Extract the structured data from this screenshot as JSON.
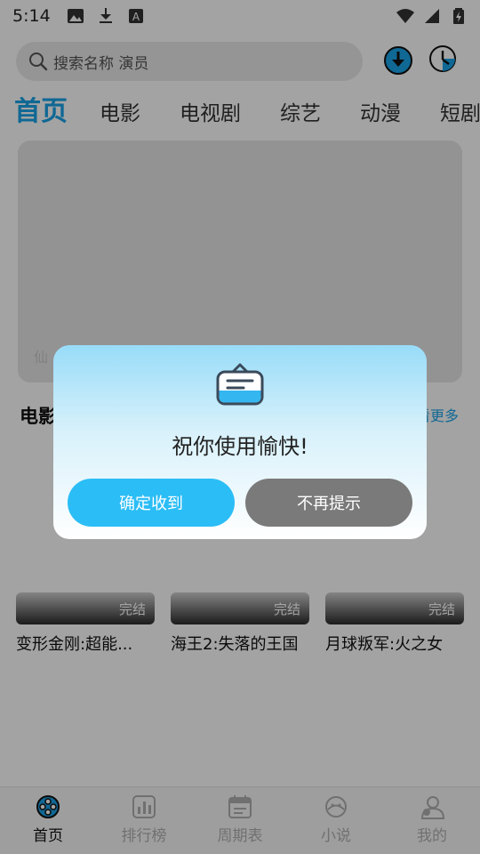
{
  "status_bar": {
    "time": "5:14",
    "icons_left": [
      "image-icon",
      "download-icon",
      "font-icon"
    ],
    "icons_right": [
      "wifi-icon",
      "signal-icon",
      "battery-icon"
    ]
  },
  "search": {
    "placeholder": "搜索名称 演员",
    "download_icon": "download-circle-icon",
    "history_icon": "history-clock-icon"
  },
  "tabs": [
    {
      "label": "首页",
      "active": true
    },
    {
      "label": "电影",
      "active": false
    },
    {
      "label": "电视剧",
      "active": false
    },
    {
      "label": "综艺",
      "active": false
    },
    {
      "label": "动漫",
      "active": false
    },
    {
      "label": "短剧",
      "active": false
    }
  ],
  "banner": {
    "caption": "仙"
  },
  "section": {
    "title": "电影",
    "more": "看更多"
  },
  "movies": [
    {
      "title": "变形金刚:超能...",
      "badge": "完结"
    },
    {
      "title": "海王2:失落的王国",
      "badge": "完结"
    },
    {
      "title": "月球叛军:火之女",
      "badge": "完结"
    }
  ],
  "bottom_nav": [
    {
      "label": "首页",
      "icon": "home-film-reel-icon",
      "active": true
    },
    {
      "label": "排行榜",
      "icon": "ranking-chart-icon",
      "active": false
    },
    {
      "label": "周期表",
      "icon": "calendar-icon",
      "active": false
    },
    {
      "label": "小说",
      "icon": "novel-icon",
      "active": false
    },
    {
      "label": "我的",
      "icon": "profile-icon",
      "active": false
    }
  ],
  "dialog": {
    "icon": "message-box-icon",
    "message": "祝你使用愉快!",
    "confirm_label": "确定收到",
    "dismiss_label": "不再提示"
  },
  "colors": {
    "accent": "#1aa3e8",
    "confirm_button": "#2bbdf6",
    "dismiss_button": "#7a7a7a"
  }
}
